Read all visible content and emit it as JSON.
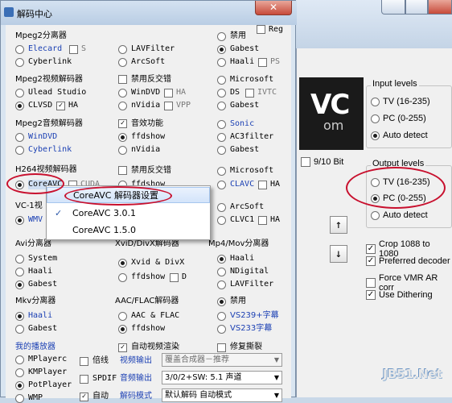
{
  "bg_window": {
    "banner_text": "VC",
    "banner_text2": "om",
    "bit_option": "9/10 Bit",
    "input_levels": {
      "title": "Input levels",
      "options": [
        "TV (16-235)",
        "PC (0-255)",
        "Auto detect"
      ],
      "selected": 2
    },
    "output_levels": {
      "title": "Output levels",
      "options": [
        "TV (16-235)",
        "PC (0-255)",
        "Auto detect"
      ],
      "selected": 1
    },
    "arrow_up": "↑",
    "arrow_down": "↓",
    "checkboxes": [
      {
        "label": "Crop 1088 to 1080",
        "checked": true
      },
      {
        "label": "Preferred decoder",
        "checked": true
      },
      {
        "label": "Force VMR AR corr",
        "checked": false
      },
      {
        "label": "Use Dithering",
        "checked": true
      }
    ]
  },
  "main_window": {
    "title": "解码中心",
    "close": "✕",
    "top_right": {
      "disable": "禁用",
      "reg": "Reg"
    },
    "mpeg2_splitter": {
      "title": "Mpeg2分离器",
      "col1": [
        "Elecard",
        "Cyberlink"
      ],
      "s": "S",
      "col2": [
        "LAVFilter",
        "ArcSoft"
      ],
      "col3": [
        "Gabest",
        "Haali"
      ],
      "ps": "PS"
    },
    "mpeg2_video": {
      "title": "Mpeg2视频解码器",
      "col1": [
        "Ulead Studio",
        "CLVSD"
      ],
      "ha": "HA",
      "col2_check": "禁用反交错",
      "col2": [
        "WinDVD",
        "nVidia"
      ],
      "ha2": "HA",
      "vpp": "VPP",
      "col3": [
        "Microsoft",
        "DS",
        "Gabest"
      ],
      "ivtc": "IVTC"
    },
    "mpeg2_audio": {
      "title": "Mpeg2音频解码器",
      "col1": [
        "WinDVD",
        "Cyberlink"
      ],
      "col2_check": "音效功能",
      "col2": [
        "ffdshow",
        "nVidia"
      ],
      "col3": [
        "Sonic",
        "AC3filter",
        "Gabest"
      ]
    },
    "h264": {
      "title": "H264视频解码器",
      "col1": [
        "CoreAVC"
      ],
      "cuda": "CUDA",
      "col2_check": "禁用反交错",
      "col2": [
        "ffdshow"
      ],
      "col3": [
        "Microsoft",
        "CLAVC"
      ],
      "ha": "HA"
    },
    "vc1": {
      "title": "VC-1视",
      "col1": [
        "WMV"
      ],
      "col3": [
        "ArcSoft",
        "CLVC1"
      ],
      "ha": "HA"
    },
    "avi_splitter": {
      "title": "Avi分离器",
      "col1": [
        "System",
        "Haali",
        "Gabest"
      ],
      "col2_title": "XviD/DivX解码器",
      "col2": [
        "Xvid & DivX",
        "ffdshow"
      ],
      "d": "D",
      "col3_title": "Mp4/Mov分离器",
      "col3": [
        "Haali",
        "NDigital",
        "LAVFilter"
      ]
    },
    "mkv": {
      "title": "Mkv分离器",
      "col1": [
        "Haali",
        "Gabest"
      ],
      "col2_title": "AAC/FLAC解码器",
      "col2": [
        "AAC & FLAC",
        "ffdshow"
      ],
      "col3_disable": "禁用",
      "col3": [
        "VS239+字幕",
        "VS233字幕"
      ]
    },
    "player": {
      "title": "我的播放器",
      "items": [
        "MPlayerc",
        "KMPlayer",
        "PotPlayer",
        "WMP"
      ],
      "times": "倍线",
      "video_out": "视频输出",
      "video_out_value": "覆盖合成器－推荐",
      "spdif": "SPDIF",
      "audio_out": "音频输出",
      "audio_out_value": "3/0/2+SW: 5.1 声道",
      "auto_render": "自动视频渲染",
      "fix_tearing": "修复撕裂",
      "auto": "自动",
      "decode_mode": "解码模式",
      "decode_mode_value": "默认解码 自动模式"
    }
  },
  "context_menu": {
    "items": [
      "CoreAVC 解码器设置",
      "CoreAVC 3.0.1",
      "CoreAVC 1.5.0"
    ],
    "checked_index": 1,
    "check_glyph": "✓"
  },
  "watermark": "JB51.Net",
  "colors": {
    "annotation": "#c8102e",
    "link_blue": "#1a3fb3"
  }
}
